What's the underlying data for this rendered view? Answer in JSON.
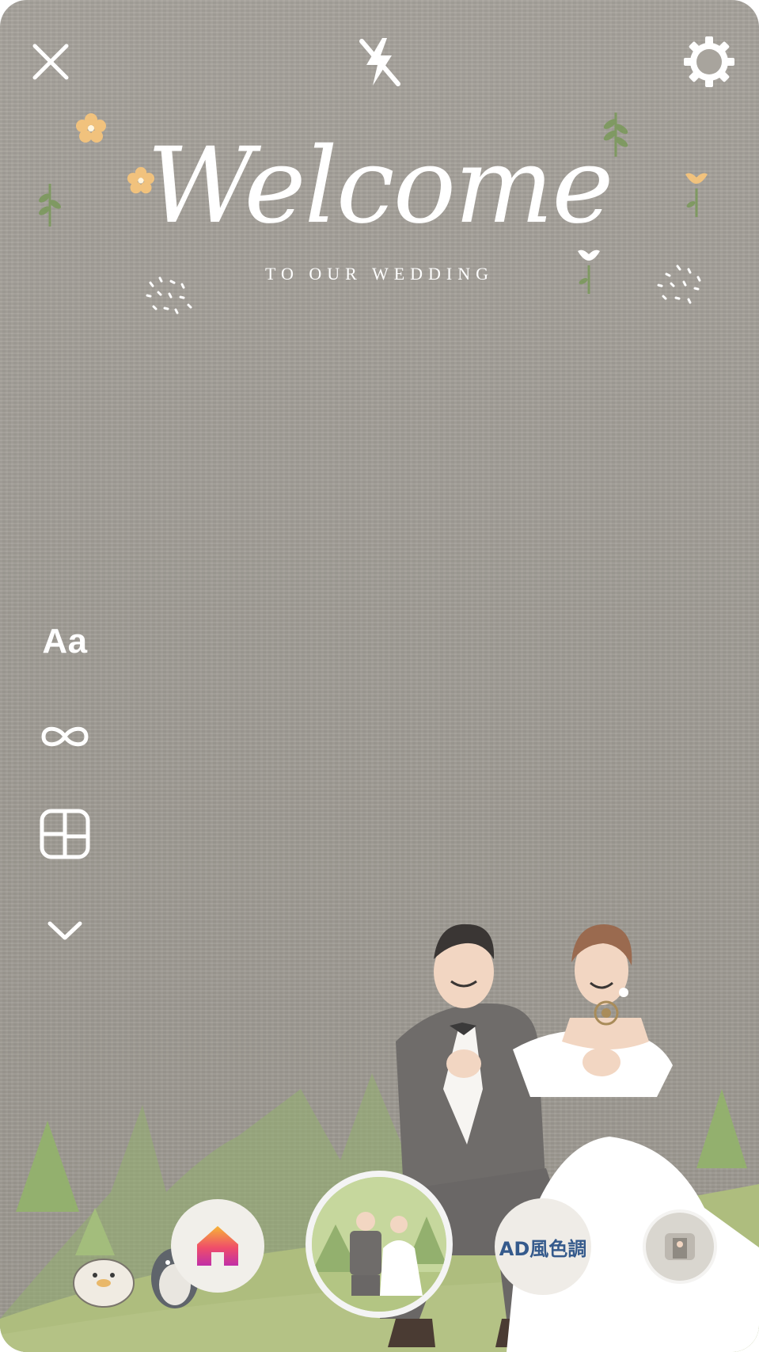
{
  "top_bar": {
    "close_icon": "close-icon",
    "flash_icon": "flash-off-icon",
    "settings_icon": "gear-icon"
  },
  "side_tools": {
    "text_label": "Aa",
    "boomerang_icon": "infinity-icon",
    "layout_icon": "layout-icon",
    "more_icon": "chevron-down-icon"
  },
  "filter_overlay": {
    "title": "Welcome",
    "subtitle": "TO OUR WEDDING"
  },
  "dock": {
    "home_icon": "home-icon",
    "effect_label": "AD風色調",
    "capture": "capture-button"
  },
  "colors": {
    "background": "#a29e97",
    "grass": "#aebd7e",
    "tree": "#93b06e",
    "flower_orange": "#f1c27d",
    "home_gradient_start": "#f7b436",
    "home_gradient_end": "#c12fa7",
    "effect_text": "#355a8c"
  }
}
